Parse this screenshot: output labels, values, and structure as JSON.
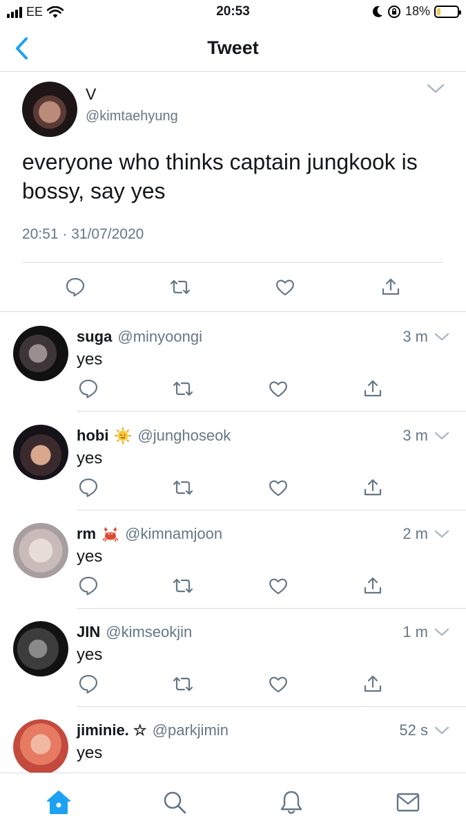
{
  "status_bar": {
    "carrier": "EE",
    "time": "20:53",
    "battery": "18%",
    "battery_level": 0.18
  },
  "nav": {
    "title": "Tweet"
  },
  "main_tweet": {
    "name": "V",
    "handle": "@kimtaehyung",
    "text": "everyone who thinks captain jungkook is bossy, say yes",
    "timestamp": "20:51 · 31/07/2020"
  },
  "replies": [
    {
      "name": "suga",
      "emoji": "",
      "handle": "@minyoongi",
      "time": "3 m",
      "text": "yes"
    },
    {
      "name": "hobi",
      "emoji": "sun-face-icon",
      "handle": "@junghoseok",
      "time": "3 m",
      "text": "yes"
    },
    {
      "name": "rm",
      "emoji": "crab-icon",
      "handle": "@kimnamjoon",
      "time": "2 m",
      "text": "yes"
    },
    {
      "name": "JIN",
      "emoji": "",
      "handle": "@kimseokjin",
      "time": "1 m",
      "text": "yes"
    },
    {
      "name": "jiminie. ☆",
      "emoji": "",
      "handle": "@parkjimin",
      "time": "52 s",
      "text": "yes"
    }
  ],
  "tab_bar": [
    "home-icon",
    "search-icon",
    "notifications-icon",
    "messages-icon"
  ],
  "colors": {
    "accent": "#1da1f2",
    "secondary_text": "#657786",
    "divider": "#d8dde1",
    "icon": "#657786"
  }
}
